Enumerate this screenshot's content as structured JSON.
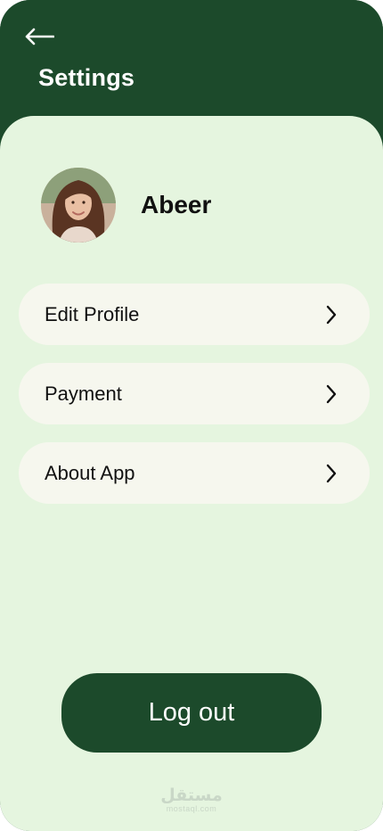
{
  "header": {
    "title": "Settings"
  },
  "profile": {
    "name": "Abeer"
  },
  "menu": {
    "items": [
      {
        "label": "Edit Profile",
        "icon": "chevron-right-icon"
      },
      {
        "label": "Payment",
        "icon": "chevron-right-icon"
      },
      {
        "label": "About App",
        "icon": "chevron-right-icon"
      }
    ]
  },
  "actions": {
    "logout_label": "Log out"
  },
  "watermark": {
    "logo": "مستقل",
    "text": "mostaql.com"
  },
  "colors": {
    "primary": "#1c4a2b",
    "panel": "#e5f5df",
    "item": "#f6f7ee",
    "text": "#111111"
  }
}
